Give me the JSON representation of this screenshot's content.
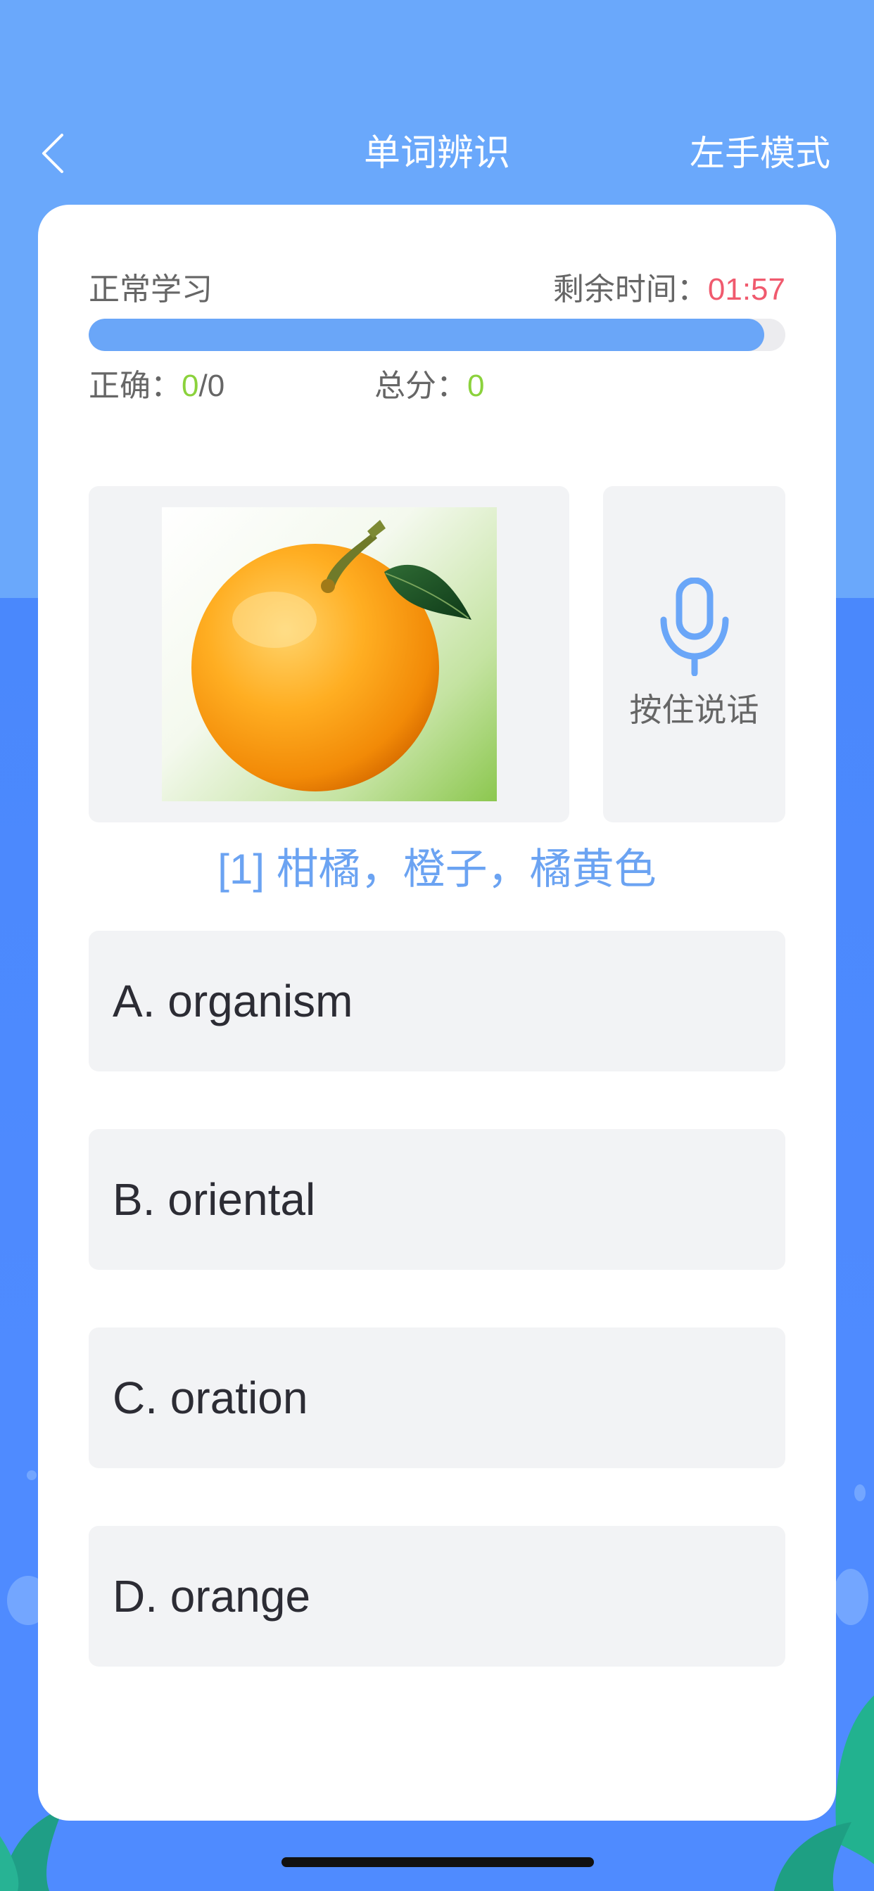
{
  "nav": {
    "title": "单词辨识",
    "right_action": "左手模式"
  },
  "status": {
    "mode": "正常学习",
    "timer_label": "剩余时间：",
    "timer_value": "01:57",
    "progress": 0.97,
    "correct_label": "正确：",
    "correct_count": "0",
    "correct_total": "/0",
    "score_label": "总分：",
    "score_value": "0"
  },
  "mic": {
    "label": "按住说话"
  },
  "question": {
    "meaning": "[1] 柑橘，橙子，橘黄色"
  },
  "options": [
    {
      "label": "A. organism"
    },
    {
      "label": "B. oriental"
    },
    {
      "label": "C. oration"
    },
    {
      "label": "D. orange"
    }
  ],
  "colors": {
    "accent_blue": "#6aa6f8",
    "timer_red": "#f05a6e",
    "score_green": "#8bd23c"
  }
}
